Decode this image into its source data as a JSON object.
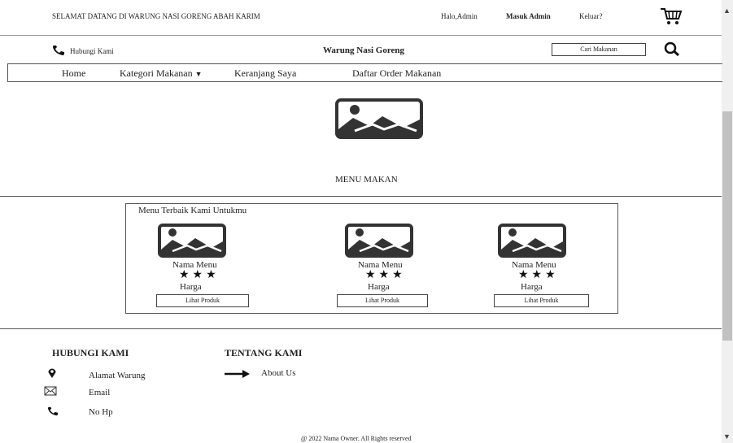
{
  "topbar": {
    "welcome": "SELAMAT DATANG DI WARUNG NASI GORENG ABAH KARIM",
    "greeting": "Halo,Admin",
    "login": "Masuk Admin",
    "logout": "Keluar?"
  },
  "header": {
    "contact": "Hubungi Kami",
    "title": "Warung Nasi Goreng",
    "search_placeholder": "Cari Makanan"
  },
  "nav": {
    "items": [
      "Home",
      "Kategori Makanan",
      "Keranjang Saya",
      "Daftar Order Makanan"
    ]
  },
  "hero": {
    "label": "MENU MAKAN"
  },
  "menu_section": {
    "heading": "Menu Terbaik Kami Untukmu",
    "cards": [
      {
        "name": "Nama Menu",
        "stars": "★★★",
        "price": "Harga",
        "button": "Lihat Produk"
      },
      {
        "name": "Nama Menu",
        "stars": "★★★",
        "price": "Harga",
        "button": "Lihat Produk"
      },
      {
        "name": "Nama Menu",
        "stars": "★★★",
        "price": "Harga",
        "button": "Lihat Produk"
      }
    ]
  },
  "footer": {
    "contact_heading": "HUBUNGI KAMI",
    "about_heading": "TENTANG KAMI",
    "address": "Alamat Warung",
    "email": "Email",
    "phone": "No Hp",
    "about_link": "About Us",
    "copyright": "@ 2022 Nama Owner. All Rights reserved"
  },
  "icons": {
    "cart": "cart-icon",
    "phone": "phone-icon",
    "search": "search-icon",
    "image": "image-placeholder-icon",
    "location": "location-pin-icon",
    "mail": "mail-icon",
    "arrow": "arrow-right-icon",
    "dropdown": "caret-down-icon"
  }
}
